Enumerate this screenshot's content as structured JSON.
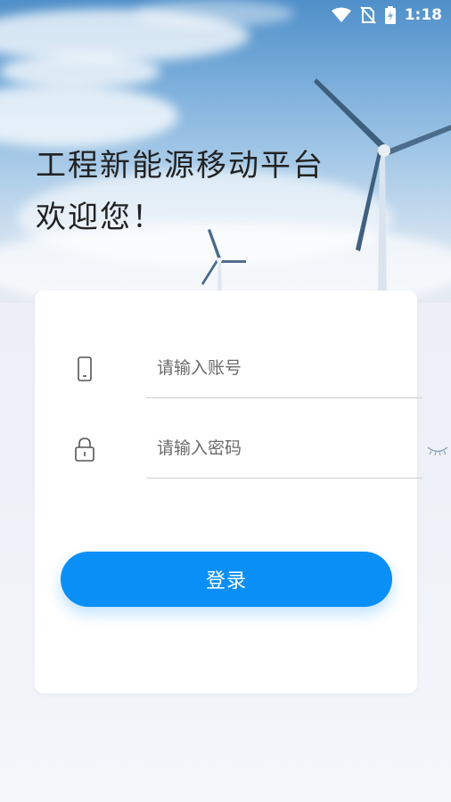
{
  "status_bar": {
    "time": "1:18",
    "icons": [
      "wifi-icon",
      "no-sim-icon",
      "battery-charging-icon"
    ]
  },
  "headline": {
    "title": "工程新能源移动平台",
    "welcome": "欢迎您！"
  },
  "login_form": {
    "account": {
      "icon": "phone-icon",
      "placeholder": "请输入账号",
      "value": ""
    },
    "password": {
      "icon": "lock-icon",
      "placeholder": "请输入密码",
      "value": "",
      "toggle_icon": "eye-closed-icon"
    },
    "submit_label": "登录"
  },
  "colors": {
    "accent": "#0a8ff7",
    "text_primary": "#222222",
    "input_line": "#cfcfcf",
    "background": "#eef1f7"
  }
}
